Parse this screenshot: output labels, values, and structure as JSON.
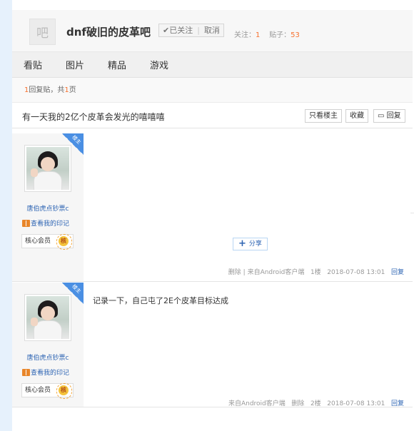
{
  "forum": {
    "logo_glyph": "吧",
    "name": "dnf破旧的皮革吧",
    "follow_label": "✔已关注",
    "cancel_label": "取消",
    "follow_count_label": "关注：",
    "follow_count": "1",
    "post_count_label": "贴子：",
    "post_count": "53"
  },
  "nav": {
    "items": [
      "看贴",
      "图片",
      "精品",
      "游戏"
    ]
  },
  "pager": {
    "reply_count": "1",
    "reply_text": "回复贴，共",
    "page_count": "1",
    "page_suffix": "页"
  },
  "thread": {
    "title": "有一天我的2亿个皮革会发光的嘻嘻嘻",
    "only_op_label": "只看楼主",
    "favorite_label": "收藏",
    "reply_label": "回复"
  },
  "posts": [
    {
      "badge": "楼主",
      "username": "唐伯虎点钞票c",
      "mark_label": "查看我的印记",
      "member_label": "核心会员",
      "member_icon": "核",
      "content": "",
      "share_label": "分享",
      "delete_label": "删除",
      "source_label": "来自Android客户端",
      "floor": "1楼",
      "time": "2018-07-08 13:01",
      "reply_label": "回复"
    },
    {
      "badge": "楼主",
      "username": "唐伯虎点钞票c",
      "mark_label": "查看我的印记",
      "member_label": "核心会员",
      "member_icon": "核",
      "content": "记录一下，自己屯了2E个皮革目标达成",
      "source_label": "来自Android客户端",
      "delete_label": "删除",
      "floor": "2楼",
      "time": "2018-07-08 13:01",
      "reply_label": "回复"
    }
  ]
}
